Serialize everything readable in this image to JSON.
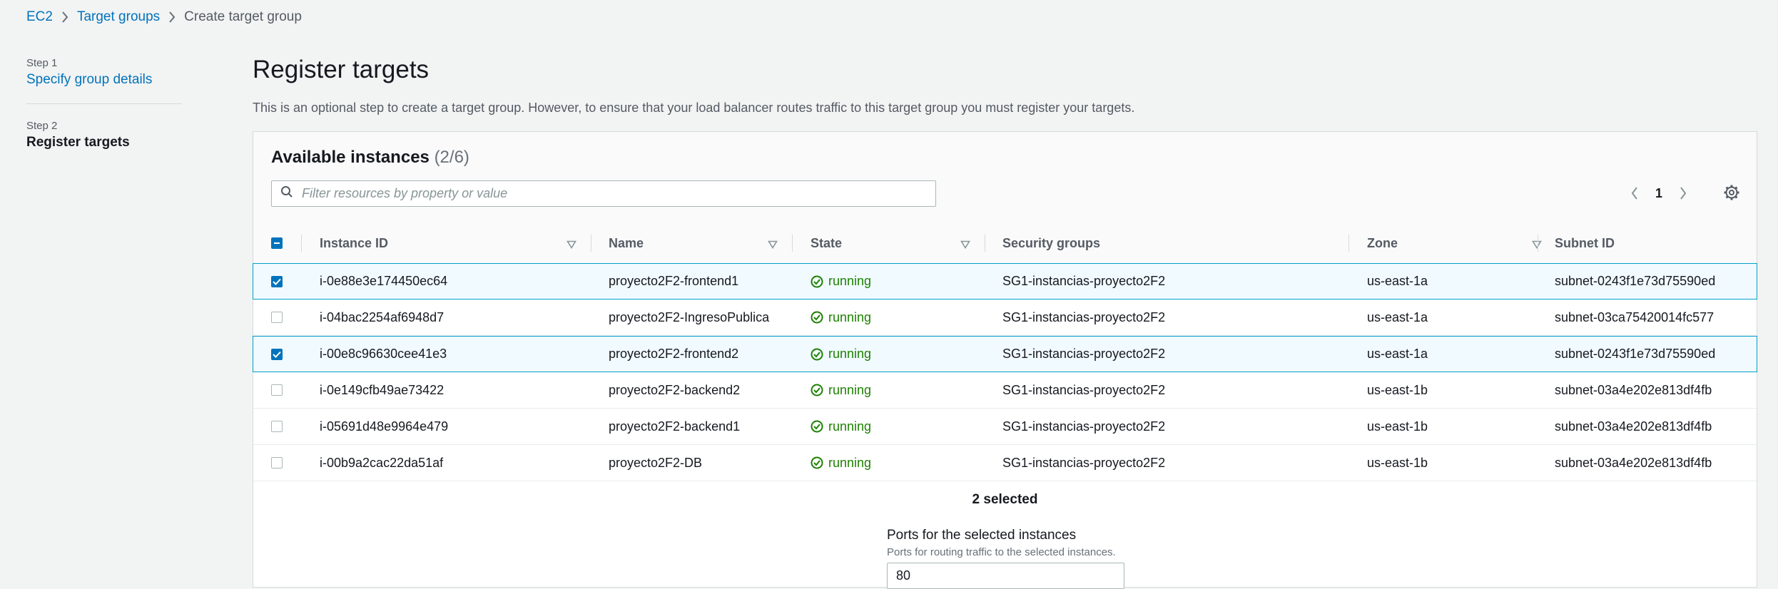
{
  "breadcrumb": {
    "items": [
      "EC2",
      "Target groups"
    ],
    "current": "Create target group"
  },
  "steps": [
    {
      "label": "Step 1",
      "title": "Specify group details"
    },
    {
      "label": "Step 2",
      "title": "Register targets"
    }
  ],
  "page": {
    "title": "Register targets",
    "description": "This is an optional step to create a target group. However, to ensure that your load balancer routes traffic to this target group you must register your targets."
  },
  "instances": {
    "title": "Available instances",
    "count": "(2/6)",
    "search_placeholder": "Filter resources by property or value",
    "page": "1",
    "columns": [
      "Instance ID",
      "Name",
      "State",
      "Security groups",
      "Zone",
      "Subnet ID"
    ],
    "rows": [
      {
        "checked": true,
        "id": "i-0e88e3e174450ec64",
        "name": "proyecto2F2-frontend1",
        "state": "running",
        "sg": "SG1-instancias-proyecto2F2",
        "zone": "us-east-1a",
        "subnet": "subnet-0243f1e73d75590ed"
      },
      {
        "checked": false,
        "id": "i-04bac2254af6948d7",
        "name": "proyecto2F2-IngresoPublica",
        "state": "running",
        "sg": "SG1-instancias-proyecto2F2",
        "zone": "us-east-1a",
        "subnet": "subnet-03ca75420014fc577"
      },
      {
        "checked": true,
        "id": "i-00e8c96630cee41e3",
        "name": "proyecto2F2-frontend2",
        "state": "running",
        "sg": "SG1-instancias-proyecto2F2",
        "zone": "us-east-1a",
        "subnet": "subnet-0243f1e73d75590ed"
      },
      {
        "checked": false,
        "id": "i-0e149cfb49ae73422",
        "name": "proyecto2F2-backend2",
        "state": "running",
        "sg": "SG1-instancias-proyecto2F2",
        "zone": "us-east-1b",
        "subnet": "subnet-03a4e202e813df4fb"
      },
      {
        "checked": false,
        "id": "i-05691d48e9964e479",
        "name": "proyecto2F2-backend1",
        "state": "running",
        "sg": "SG1-instancias-proyecto2F2",
        "zone": "us-east-1b",
        "subnet": "subnet-03a4e202e813df4fb"
      },
      {
        "checked": false,
        "id": "i-00b9a2cac22da51af",
        "name": "proyecto2F2-DB",
        "state": "running",
        "sg": "SG1-instancias-proyecto2F2",
        "zone": "us-east-1b",
        "subnet": "subnet-03a4e202e813df4fb"
      }
    ],
    "selected_text": "2 selected"
  },
  "ports": {
    "label": "Ports for the selected instances",
    "description": "Ports for routing traffic to the selected instances.",
    "value": "80"
  },
  "colors": {
    "link": "#0073bb",
    "success": "#1d8102",
    "selected_border": "#00a1c9",
    "selected_bg": "#f1faff"
  },
  "icons": {
    "search": "search-icon",
    "settings": "gear-icon",
    "status": "check-circle-icon",
    "sort": "caret-down-icon"
  }
}
